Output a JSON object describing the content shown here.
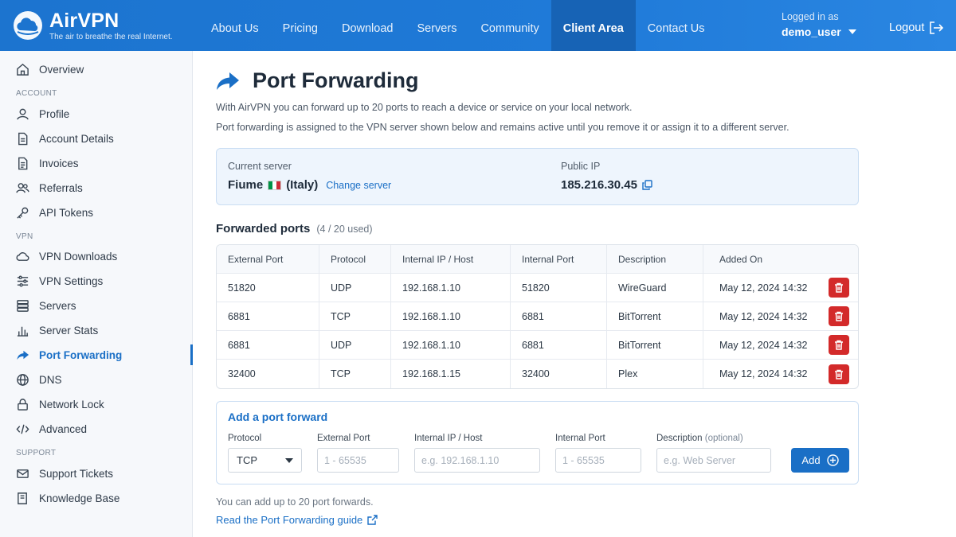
{
  "brand": {
    "name": "AirVPN",
    "tagline": "The air to breathe the real Internet."
  },
  "nav": {
    "items": [
      "About Us",
      "Pricing",
      "Download",
      "Servers",
      "Community",
      "Client Area",
      "Contact Us"
    ],
    "active": "Client Area"
  },
  "user": {
    "caption": "Logged in as",
    "name": "demo_user",
    "logout": "Logout"
  },
  "sidebar": {
    "overview": "Overview",
    "section_account": "ACCOUNT",
    "profile": "Profile",
    "account_details": "Account Details",
    "invoices": "Invoices",
    "referrals": "Referrals",
    "api_tokens": "API Tokens",
    "section_vpn": "VPN",
    "vpn_downloads": "VPN Downloads",
    "vpn_settings": "VPN Settings",
    "servers": "Servers",
    "server_stats": "Server Stats",
    "port_forwarding": "Port Forwarding",
    "dns": "DNS",
    "network_lock": "Network Lock",
    "advanced": "Advanced",
    "section_support": "SUPPORT",
    "support_tickets": "Support Tickets",
    "knowledge_base": "Knowledge Base",
    "active": "Port Forwarding"
  },
  "page": {
    "title": "Port Forwarding",
    "intro1": "With AirVPN you can forward up to 20 ports to reach a device or service on your local network.",
    "intro2": "Port forwarding is assigned to the VPN server shown below and remains active until you remove it or assign it to a different server."
  },
  "server": {
    "current_label": "Current server",
    "name": "Fiume",
    "country": "(Italy)",
    "change_link": "Change server",
    "ip_label": "Public IP",
    "ip": "185.216.30.45",
    "flag_colors": [
      "#009246",
      "#ffffff",
      "#ce2b37"
    ]
  },
  "forwarded": {
    "title": "Forwarded ports",
    "count": "(4 / 20 used)",
    "headers": {
      "external_port": "External Port",
      "protocol": "Protocol",
      "internal_ip": "Internal IP / Host",
      "internal_port": "Internal Port",
      "description": "Description",
      "added_on": "Added On"
    },
    "rows": [
      {
        "external_port": "51820",
        "protocol": "UDP",
        "internal_ip": "192.168.1.10",
        "internal_port": "51820",
        "description": "WireGuard",
        "added_on": "May 12, 2024 14:32"
      },
      {
        "external_port": "6881",
        "protocol": "TCP",
        "internal_ip": "192.168.1.10",
        "internal_port": "6881",
        "description": "BitTorrent",
        "added_on": "May 12, 2024 14:32"
      },
      {
        "external_port": "6881",
        "protocol": "UDP",
        "internal_ip": "192.168.1.10",
        "internal_port": "6881",
        "description": "BitTorrent",
        "added_on": "May 12, 2024 14:32"
      },
      {
        "external_port": "32400",
        "protocol": "TCP",
        "internal_ip": "192.168.1.15",
        "internal_port": "32400",
        "description": "Plex",
        "added_on": "May 12, 2024 14:32"
      }
    ]
  },
  "add_form": {
    "title": "Add a port forward",
    "protocol_label": "Protocol",
    "protocol_value": "TCP",
    "external_port_label": "External Port",
    "external_port_placeholder": "1 - 65535",
    "internal_ip_label": "Internal IP / Host",
    "internal_ip_placeholder": "e.g. 192.168.1.10",
    "internal_port_label": "Internal Port",
    "internal_port_placeholder": "1 - 65535",
    "description_label": "Description",
    "description_optional": "(optional)",
    "description_placeholder": "e.g. Web Server",
    "add_button": "Add"
  },
  "footer": {
    "note": "You can add up to 20 port forwards.",
    "guide_link": "Read the Port Forwarding guide"
  },
  "colors": {
    "primary": "#1a6fc6",
    "nav_active": "#1763b5",
    "delete": "#d32a2a"
  }
}
